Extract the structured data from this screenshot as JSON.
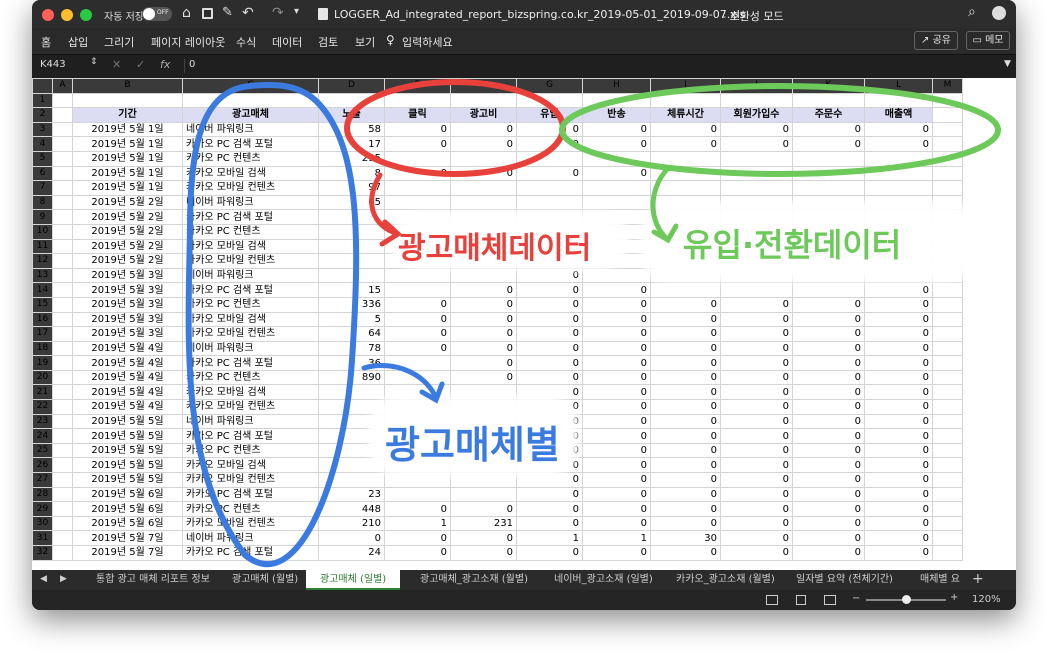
{
  "titlebar": {
    "autosave_label": "자동 저장",
    "toggle_state": "OFF",
    "filename": "LOGGER_Ad_integrated_report_bizspring.co.kr_2019-05-01_2019-09-07.xls",
    "mode": "- 호환성 모드"
  },
  "ribbon": {
    "tabs": [
      "홈",
      "삽입",
      "그리기",
      "페이지 레이아웃",
      "수식",
      "데이터",
      "검토",
      "보기"
    ],
    "tell_me": "입력하세요",
    "share": "공유",
    "comment": "메모"
  },
  "formula_bar": {
    "cell_ref": "K443",
    "fx": "fx",
    "value": "0"
  },
  "columns": [
    "A",
    "B",
    "C",
    "D",
    "E",
    "F",
    "G",
    "H",
    "I",
    "J",
    "K",
    "L",
    "M"
  ],
  "headers": [
    "기간",
    "광고매체",
    "노출",
    "클릭",
    "광고비",
    "유입",
    "반송",
    "체류시간",
    "회원가입수",
    "주문수",
    "매출액"
  ],
  "rows": [
    {
      "n": "3",
      "date": "2019년 5월 1일",
      "media": "네이버 파워링크",
      "v": [
        "58",
        "0",
        "0",
        "0",
        "0",
        "0",
        "0",
        "0",
        "0"
      ]
    },
    {
      "n": "4",
      "date": "2019년 5월 1일",
      "media": "카카오 PC 검색 포털",
      "v": [
        "17",
        "0",
        "0",
        "0",
        "0",
        "0",
        "0",
        "0",
        "0"
      ]
    },
    {
      "n": "5",
      "date": "2019년 5월 1일",
      "media": "카카오 PC 컨텐츠",
      "v": [
        "295",
        "",
        "",
        "",
        "",
        "",
        "",
        "",
        ""
      ]
    },
    {
      "n": "6",
      "date": "2019년 5월 1일",
      "media": "카카오 모바일 검색",
      "v": [
        "8",
        "0",
        "0",
        "0",
        "0",
        "",
        "",
        "",
        ""
      ]
    },
    {
      "n": "7",
      "date": "2019년 5월 1일",
      "media": "카카오 모바일 컨텐츠",
      "v": [
        "97",
        "",
        "",
        "",
        "",
        "",
        "",
        "",
        ""
      ]
    },
    {
      "n": "8",
      "date": "2019년 5월 2일",
      "media": "네이버 파워링크",
      "v": [
        "65",
        "",
        "",
        "",
        "",
        "",
        "",
        "",
        ""
      ]
    },
    {
      "n": "9",
      "date": "2019년 5월 2일",
      "media": "카카오 PC 검색 포털",
      "v": [
        "",
        "",
        "",
        "",
        "",
        "",
        "",
        "",
        ""
      ]
    },
    {
      "n": "10",
      "date": "2019년 5월 2일",
      "media": "카카오 PC 컨텐츠",
      "v": [
        "",
        "",
        "",
        "",
        "",
        "",
        "",
        "",
        ""
      ]
    },
    {
      "n": "11",
      "date": "2019년 5월 2일",
      "media": "카카오 모바일 검색",
      "v": [
        "",
        "",
        "",
        "",
        "",
        "",
        "",
        "",
        ""
      ]
    },
    {
      "n": "12",
      "date": "2019년 5월 2일",
      "media": "카카오 모바일 컨텐츠",
      "v": [
        "",
        "",
        "",
        "",
        "",
        "",
        "",
        "",
        ""
      ]
    },
    {
      "n": "13",
      "date": "2019년 5월 3일",
      "media": "네이버 파워링크",
      "v": [
        "",
        "",
        "",
        "0",
        "",
        "",
        "",
        "",
        ""
      ]
    },
    {
      "n": "14",
      "date": "2019년 5월 3일",
      "media": "카카오 PC 검색 포털",
      "v": [
        "15",
        "",
        "0",
        "0",
        "0",
        "",
        "",
        "",
        "0"
      ]
    },
    {
      "n": "15",
      "date": "2019년 5월 3일",
      "media": "카카오 PC 컨텐츠",
      "v": [
        "336",
        "0",
        "0",
        "0",
        "0",
        "0",
        "0",
        "0",
        "0"
      ]
    },
    {
      "n": "16",
      "date": "2019년 5월 3일",
      "media": "카카오 모바일 검색",
      "v": [
        "5",
        "0",
        "0",
        "0",
        "0",
        "0",
        "0",
        "0",
        "0"
      ]
    },
    {
      "n": "17",
      "date": "2019년 5월 3일",
      "media": "카카오 모바일 컨텐츠",
      "v": [
        "64",
        "0",
        "0",
        "0",
        "0",
        "0",
        "0",
        "0",
        "0"
      ]
    },
    {
      "n": "18",
      "date": "2019년 5월 4일",
      "media": "네이버 파워링크",
      "v": [
        "78",
        "0",
        "0",
        "0",
        "0",
        "0",
        "0",
        "0",
        "0"
      ]
    },
    {
      "n": "19",
      "date": "2019년 5월 4일",
      "media": "카카오 PC 검색 포털",
      "v": [
        "36",
        "",
        "0",
        "0",
        "0",
        "0",
        "0",
        "0",
        "0"
      ]
    },
    {
      "n": "20",
      "date": "2019년 5월 4일",
      "media": "카카오 PC 컨텐츠",
      "v": [
        "890",
        "",
        "0",
        "0",
        "0",
        "0",
        "0",
        "0",
        "0"
      ]
    },
    {
      "n": "21",
      "date": "2019년 5월 4일",
      "media": "카카오 모바일 검색",
      "v": [
        "",
        "",
        "",
        "0",
        "0",
        "0",
        "0",
        "0",
        "0"
      ]
    },
    {
      "n": "22",
      "date": "2019년 5월 4일",
      "media": "카카오 모바일 컨텐츠",
      "v": [
        "",
        "",
        "",
        "0",
        "0",
        "0",
        "0",
        "0",
        "0"
      ]
    },
    {
      "n": "23",
      "date": "2019년 5월 5일",
      "media": "네이버 파워링크",
      "v": [
        "",
        "",
        "",
        "0",
        "0",
        "0",
        "0",
        "0",
        "0"
      ]
    },
    {
      "n": "24",
      "date": "2019년 5월 5일",
      "media": "카카오 PC 검색 포털",
      "v": [
        "",
        "",
        "",
        "0",
        "0",
        "0",
        "0",
        "0",
        "0"
      ]
    },
    {
      "n": "25",
      "date": "2019년 5월 5일",
      "media": "카카오 PC 컨텐츠",
      "v": [
        "",
        "",
        "",
        "0",
        "0",
        "0",
        "0",
        "0",
        "0"
      ]
    },
    {
      "n": "26",
      "date": "2019년 5월 5일",
      "media": "카카오 모바일 검색",
      "v": [
        "",
        "",
        "",
        "0",
        "0",
        "0",
        "0",
        "0",
        "0"
      ]
    },
    {
      "n": "27",
      "date": "2019년 5월 5일",
      "media": "카카오 모바일 컨텐츠",
      "v": [
        "",
        "",
        "",
        "0",
        "0",
        "0",
        "0",
        "0",
        "0"
      ]
    },
    {
      "n": "28",
      "date": "2019년 5월 6일",
      "media": "카카오 PC 검색 포털",
      "v": [
        "23",
        "",
        "",
        "0",
        "0",
        "0",
        "0",
        "0",
        "0"
      ]
    },
    {
      "n": "29",
      "date": "2019년 5월 6일",
      "media": "카카오 PC 컨텐츠",
      "v": [
        "448",
        "0",
        "0",
        "0",
        "0",
        "0",
        "0",
        "0",
        "0"
      ]
    },
    {
      "n": "30",
      "date": "2019년 5월 6일",
      "media": "카카오 모바일 컨텐츠",
      "v": [
        "210",
        "1",
        "231",
        "0",
        "0",
        "0",
        "0",
        "0",
        "0"
      ]
    },
    {
      "n": "31",
      "date": "2019년 5월 7일",
      "media": "네이버 파워링크",
      "v": [
        "0",
        "0",
        "0",
        "1",
        "1",
        "30",
        "0",
        "0",
        "0"
      ]
    },
    {
      "n": "32",
      "date": "2019년 5월 7일",
      "media": "카카오 PC 검색 포털",
      "v": [
        "24",
        "0",
        "0",
        "0",
        "0",
        "0",
        "0",
        "0",
        "0"
      ]
    }
  ],
  "sheet_tabs": [
    "통합 광고 매체 리포트 정보",
    "광고매체 (월별)",
    "광고매체 (일별)",
    "광고매체_광고소재 (월별)",
    "네이버_광고소재 (일별)",
    "카카오_광고소재 (월별)",
    "일자별 요약 (전체기간)",
    "매체별 요"
  ],
  "zoom": "120%",
  "annotations": {
    "ad_media_data": "광고매체데이터",
    "inflow_conversion_data": "유입·전환데이터",
    "by_ad_media": "광고매체별"
  },
  "colors": {
    "red": "#e8413c",
    "green": "#6cc95a",
    "blue": "#3b7be0",
    "header_fill": "#dcdcf2"
  }
}
